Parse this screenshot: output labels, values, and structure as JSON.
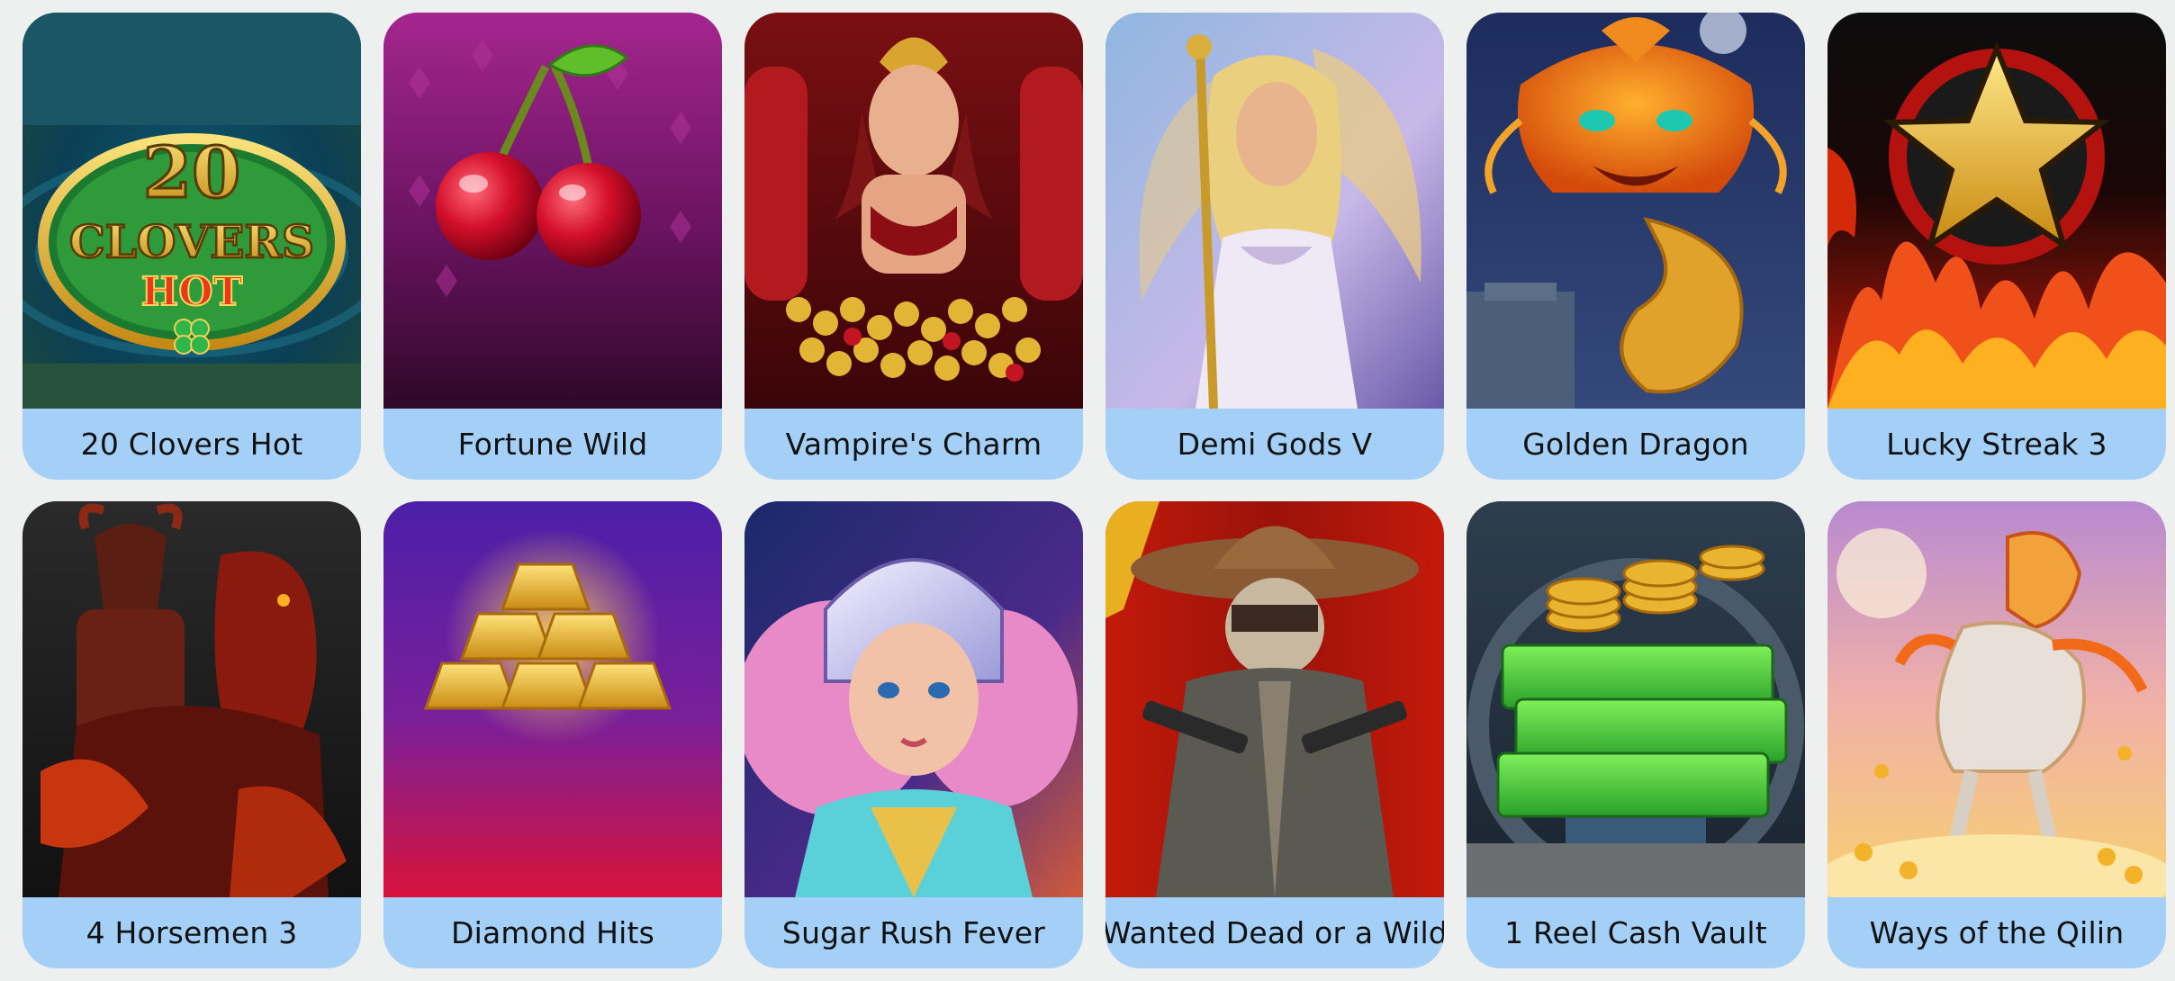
{
  "games": [
    {
      "title": "20 Clovers Hot",
      "art": "clover-slot-icon",
      "logo_text": "20 CLOVERS HOT"
    },
    {
      "title": "Fortune Wild",
      "art": "cherry-icon"
    },
    {
      "title": "Vampire's Charm",
      "art": "vampire-queen-icon"
    },
    {
      "title": "Demi Gods V",
      "art": "goddess-icon"
    },
    {
      "title": "Golden Dragon",
      "art": "dragon-icon"
    },
    {
      "title": "Lucky Streak 3",
      "art": "gold-star-icon"
    },
    {
      "title": "4 Horsemen 3",
      "art": "horseman-icon"
    },
    {
      "title": "Diamond Hits",
      "art": "gold-bars-icon"
    },
    {
      "title": "Sugar Rush Fever",
      "art": "racer-girl-icon"
    },
    {
      "title": "Wanted Dead or a Wild",
      "art": "cowboy-gunslinger-icon"
    },
    {
      "title": "1 Reel Cash Vault",
      "art": "cash-vault-icon"
    },
    {
      "title": "Ways of the Qilin",
      "art": "qilin-icon"
    }
  ],
  "colors": {
    "page_background": "#eef0ef",
    "label_background": "#a4d0f7",
    "label_text": "#111111"
  }
}
